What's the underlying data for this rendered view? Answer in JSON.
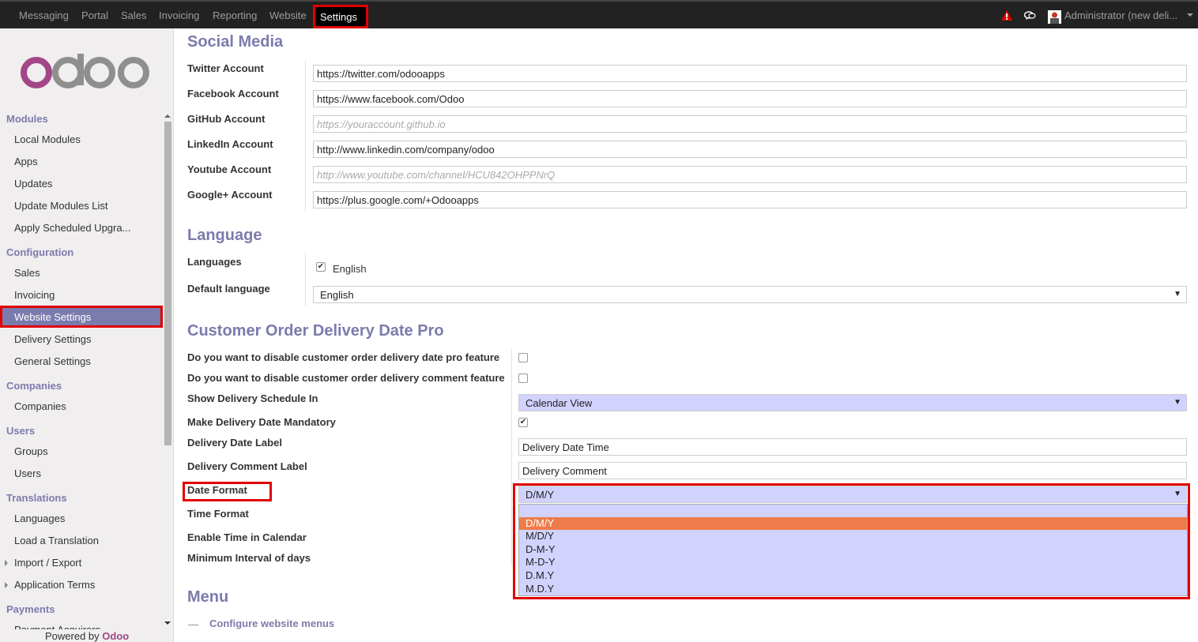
{
  "topbar": {
    "menu": [
      "Messaging",
      "Portal",
      "Sales",
      "Invoicing",
      "Reporting",
      "Website"
    ],
    "active": "Settings",
    "user": "Administrator (new  deli..."
  },
  "sidebar": {
    "powered_prefix": "Powered by ",
    "powered_brand": "Odoo",
    "sections": {
      "modules": "Modules",
      "configuration": "Configuration",
      "companies": "Companies",
      "users": "Users",
      "translations": "Translations",
      "payments": "Payments"
    },
    "items": {
      "local_modules": "Local Modules",
      "apps": "Apps",
      "updates": "Updates",
      "update_modules_list": "Update Modules List",
      "apply_upgrades": "Apply Scheduled Upgra...",
      "sales": "Sales",
      "invoicing": "Invoicing",
      "website_settings": "Website Settings",
      "delivery_settings": "Delivery Settings",
      "general_settings": "General Settings",
      "companies": "Companies",
      "groups": "Groups",
      "users": "Users",
      "languages": "Languages",
      "load_translation": "Load a Translation",
      "import_export": "Import / Export",
      "application_terms": "Application Terms",
      "payment_acquirers": "Payment Acquirers"
    }
  },
  "social": {
    "title": "Social Media",
    "twitter_label": "Twitter Account",
    "twitter_value": "https://twitter.com/odooapps",
    "facebook_label": "Facebook Account",
    "facebook_value": "https://www.facebook.com/Odoo",
    "github_label": "GitHub Account",
    "github_placeholder": "https://youraccount.github.io",
    "linkedin_label": "LinkedIn Account",
    "linkedin_value": "http://www.linkedin.com/company/odoo",
    "youtube_label": "Youtube Account",
    "youtube_placeholder": "http://www.youtube.com/channel/HCU842OHPPNrQ",
    "google_label": "Google+ Account",
    "google_value": "https://plus.google.com/+Odooapps"
  },
  "language": {
    "title": "Language",
    "languages_label": "Languages",
    "english": "English",
    "default_label": "Default language",
    "default_value": "English"
  },
  "delivery": {
    "title": "Customer Order Delivery Date Pro",
    "disable_feature_label": "Do you want to disable customer order delivery date pro feature",
    "disable_comment_label": "Do you want to disable customer order delivery comment feature",
    "schedule_label": "Show Delivery Schedule In",
    "schedule_value": "Calendar View",
    "mandatory_label": "Make Delivery Date Mandatory",
    "date_label_label": "Delivery Date Label",
    "date_label_value": "Delivery Date Time",
    "comment_label_label": "Delivery Comment Label",
    "comment_label_value": "Delivery Comment",
    "date_format_label": "Date Format",
    "date_format_value": "D/M/Y",
    "date_format_options": [
      "D/M/Y",
      "M/D/Y",
      "D-M-Y",
      "M-D-Y",
      "D.M.Y",
      "M.D.Y"
    ],
    "time_format_label": "Time Format",
    "enable_time_label": "Enable Time in Calendar",
    "min_interval_label": "Minimum Interval of days"
  },
  "menu": {
    "title": "Menu",
    "dash": "—",
    "configure": "Configure website menus"
  },
  "colors": {
    "accent": "#7c7bad",
    "highlight": "#e00000",
    "active_option": "#ee7c4a",
    "brand": "#a24689"
  }
}
